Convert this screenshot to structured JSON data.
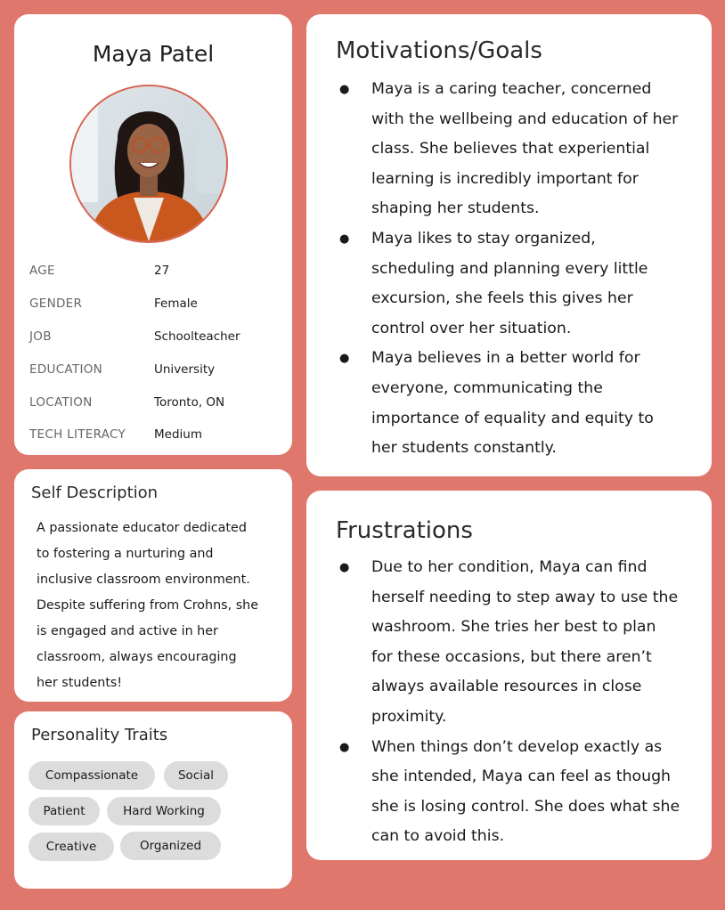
{
  "profile": {
    "name": "Maya Patel",
    "attributes": [
      {
        "label": "AGE",
        "value": "27"
      },
      {
        "label": "GENDER",
        "value": "Female"
      },
      {
        "label": "JOB",
        "value": "Schoolteacher"
      },
      {
        "label": "EDUCATION",
        "value": "University"
      },
      {
        "label": "LOCATION",
        "value": "Toronto, ON"
      },
      {
        "label": "TECH LITERACY",
        "value": "Medium"
      }
    ]
  },
  "self_description": {
    "title": "Self Description",
    "lines": [
      "A passionate educator dedicated",
      "to fostering a nurturing and",
      "inclusive classroom environment.",
      "Despite suffering from Crohns, she",
      "is engaged and active in her",
      "classroom, always encouraging",
      "her students!"
    ]
  },
  "personality": {
    "title": "Personality Traits",
    "traits": [
      "Compassionate",
      "Social",
      "Patient",
      "Hard Working",
      "Creative",
      "Organized"
    ]
  },
  "motivations": {
    "title": "Motivations/Goals",
    "items": [
      [
        "Maya is a caring teacher, concerned",
        "with the wellbeing and education of her",
        "class. She believes that experiential",
        "learning is incredibly important for",
        "shaping her students."
      ],
      [
        "Maya likes to stay organized,",
        "scheduling and planning every little",
        "excursion, she feels this gives her",
        "control over her situation."
      ],
      [
        "Maya believes in a better world for",
        "everyone, communicating the",
        "importance of equality and equity to",
        "her students constantly."
      ]
    ]
  },
  "frustrations": {
    "title": "Frustrations",
    "items": [
      [
        "Due to her condition, Maya can find",
        "herself needing to step away to use the",
        "washroom. She tries her best to plan",
        "for these occasions, but there aren’t",
        "always available resources in close",
        "proximity."
      ],
      [
        "When things don’t develop exactly as",
        "she intended, Maya can feel as though",
        "she is losing control. She does what she",
        "can to avoid this."
      ]
    ]
  },
  "bullet_glyph": "●",
  "colors": {
    "background": "#e0776c",
    "avatar_border": "#d8614f",
    "pill": "#dcdcdc"
  }
}
